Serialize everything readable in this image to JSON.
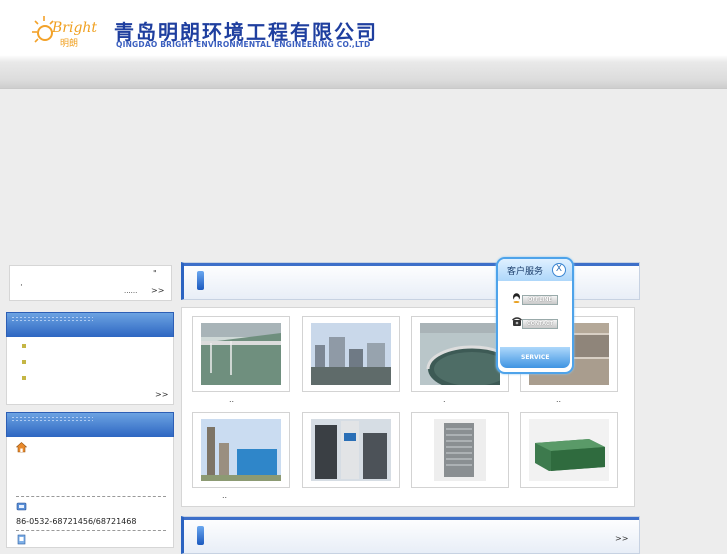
{
  "header": {
    "logo_text": "Bright",
    "logo_cn": "明朗",
    "company_cn": "青岛明朗环境工程有限公司",
    "company_en": "QINGDAO BRIGHT ENVIRONMENTAL ENGINEERING CO.,LTD"
  },
  "intro_box": {
    "quote": "\"",
    "dot": "·",
    "ellipsis": "......",
    "more": ">>"
  },
  "news_box": {
    "more": ">>"
  },
  "contact_box": {
    "phone": "86-0532-68721456/68721468"
  },
  "products": {
    "items": [
      {
        "caption": ".."
      },
      {
        "caption": ""
      },
      {
        "caption": "."
      },
      {
        "caption": ".."
      },
      {
        "caption": ".."
      },
      {
        "caption": ""
      },
      {
        "caption": ""
      },
      {
        "caption": ""
      }
    ]
  },
  "bottom_more": ">>",
  "service_popup": {
    "title": "客户服务",
    "close": "X",
    "offline": "OFFLINE",
    "contact": "CONTACT",
    "footer": "SERVICE"
  },
  "colors": {
    "brand_blue": "#1f3f9f",
    "accent_blue": "#2d66c2",
    "bullet": "#c5b645",
    "logo_orange": "#f0a020"
  }
}
